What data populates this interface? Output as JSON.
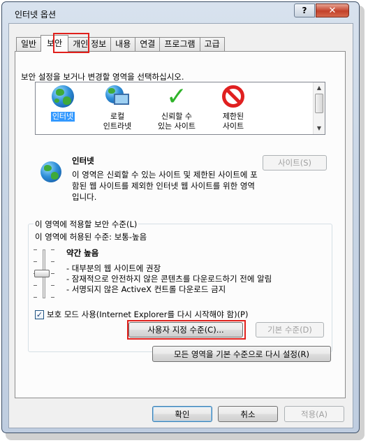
{
  "window": {
    "title": "인터넷 옵션",
    "help_label": "?",
    "close_label": "✕"
  },
  "tabs": [
    {
      "label": "일반"
    },
    {
      "label": "보안"
    },
    {
      "label": "개인 정보"
    },
    {
      "label": "내용"
    },
    {
      "label": "연결"
    },
    {
      "label": "프로그램"
    },
    {
      "label": "고급"
    }
  ],
  "security": {
    "instruction": "보안 설정을 보거나 변경할 영역을 선택하십시오.",
    "zones": [
      {
        "line1": "인터넷",
        "line2": "",
        "icon": "globe-icon"
      },
      {
        "line1": "로컬",
        "line2": "인트라넷",
        "icon": "intranet-icon"
      },
      {
        "line1": "신뢰할 수",
        "line2": "있는 사이트",
        "icon": "checkmark-icon"
      },
      {
        "line1": "제한된",
        "line2": "사이트",
        "icon": "restricted-icon"
      }
    ],
    "selected_zone": "인터넷",
    "zone_title": "인터넷",
    "zone_desc": "이 영역은 신뢰할 수 있는 사이트 및 제한된 사이트에 포함된 웹 사이트를 제외한 인터넷 웹 사이트를 위한 영역입니다.",
    "sites_button": "사이트(S)",
    "level_group_label": "이 영역에 적용할 보안 수준(L)",
    "allowed_levels": "이 영역에 허용된 수준: 보통-높음",
    "level_name": "약간 높음",
    "level_bullets": [
      "- 대부분의 웹 사이트에 권장",
      "- 잠재적으로 안전하지 않은 콘텐츠를 다운로드하기 전에 알림",
      "- 서명되지 않은 ActiveX 컨트롤 다운로드 금지"
    ],
    "protected_mode_label": "보호 모드 사용(Internet Explorer를 다시 시작해야 함)(P)",
    "protected_mode_checked": true,
    "custom_level_button": "사용자 지정 수준(C)...",
    "default_level_button": "기본 수준(D)",
    "reset_all_button": "모든 영역을 기본 수준으로 다시 설정(R)"
  },
  "footer": {
    "ok": "확인",
    "cancel": "취소",
    "apply": "적용(A)"
  },
  "colors": {
    "highlight_red": "#e0201c",
    "selection_blue": "#3399ff"
  }
}
